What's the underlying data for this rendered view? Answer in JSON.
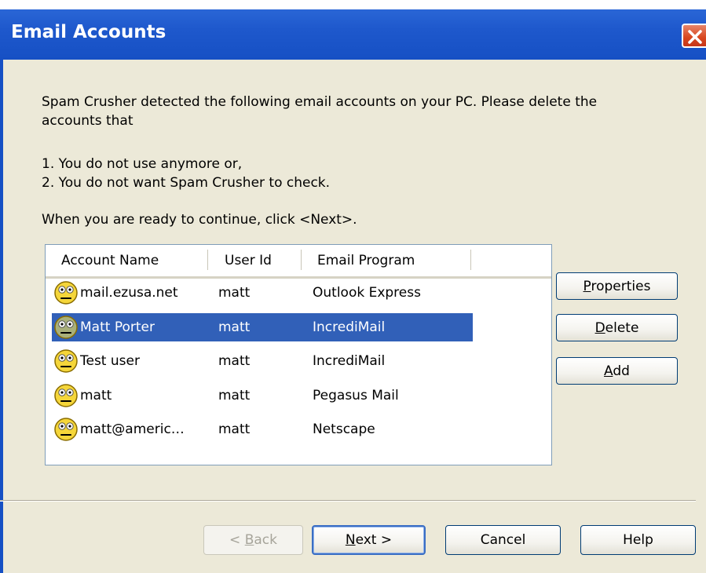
{
  "window": {
    "title": "Email Accounts",
    "close_icon": "close-icon"
  },
  "intro": {
    "line1": "Spam Crusher detected the following email accounts on your PC.  Please delete the",
    "line2": "accounts that",
    "item1": "1. You do not use anymore or,",
    "item2": "2. You do not want Spam Crusher to check.",
    "continue": "When you are ready to continue, click <Next>."
  },
  "list": {
    "columns": [
      "Account Name",
      "User Id",
      "Email Program"
    ],
    "rows": [
      {
        "name": "mail.ezusa.net",
        "user": "matt",
        "program": "Outlook Express",
        "selected": false
      },
      {
        "name": "Matt Porter",
        "user": "matt",
        "program": "IncrediMail",
        "selected": true
      },
      {
        "name": "Test user",
        "user": "matt",
        "program": "IncrediMail",
        "selected": false
      },
      {
        "name": "matt",
        "user": "matt",
        "program": "Pegasus Mail",
        "selected": false
      },
      {
        "name": "matt@americ…",
        "user": "matt",
        "program": "Netscape",
        "selected": false
      }
    ],
    "row_icon": "account-face-icon"
  },
  "side_buttons": {
    "properties_first": "P",
    "properties_rest": "roperties",
    "delete_first": "D",
    "delete_rest": "elete",
    "add_first": "A",
    "add_rest": "dd"
  },
  "footer": {
    "back_prefix": "< ",
    "back_first": "B",
    "back_rest": "ack",
    "next_first": "N",
    "next_rest": "ext >",
    "cancel": "Cancel",
    "help": "Help"
  },
  "colors": {
    "titlebar": "#1650c4",
    "selection": "#3160b8",
    "face": "#f5d63a"
  }
}
